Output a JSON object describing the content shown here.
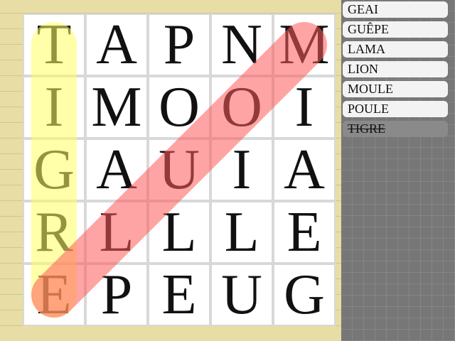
{
  "grid": {
    "rows": [
      [
        "T",
        "A",
        "P",
        "N",
        "M"
      ],
      [
        "I",
        "M",
        "O",
        "O",
        "I"
      ],
      [
        "G",
        "A",
        "U",
        "I",
        "A"
      ],
      [
        "R",
        "L",
        "L",
        "L",
        "E"
      ],
      [
        "E",
        "P",
        "E",
        "U",
        "G"
      ]
    ]
  },
  "words": [
    {
      "label": "GEAI",
      "found": false
    },
    {
      "label": "GUÊPE",
      "found": false
    },
    {
      "label": "LAMA",
      "found": false
    },
    {
      "label": "LION",
      "found": false
    },
    {
      "label": "MOULE",
      "found": false
    },
    {
      "label": "POULE",
      "found": false
    },
    {
      "label": "TIGRE",
      "found": true
    }
  ],
  "highlights": [
    {
      "word": "TIGRE",
      "color": "#ffff66",
      "from": [
        0,
        0
      ],
      "to": [
        4,
        0
      ]
    },
    {
      "word": "MOULE",
      "color": "#ff5a5a",
      "from": [
        0,
        4
      ],
      "to": [
        4,
        0
      ]
    }
  ],
  "colors": {
    "paper": "#e9dda6",
    "sidebar": "#777777",
    "yellow_highlight": "#ffff66",
    "red_highlight": "#ff5a5a"
  }
}
